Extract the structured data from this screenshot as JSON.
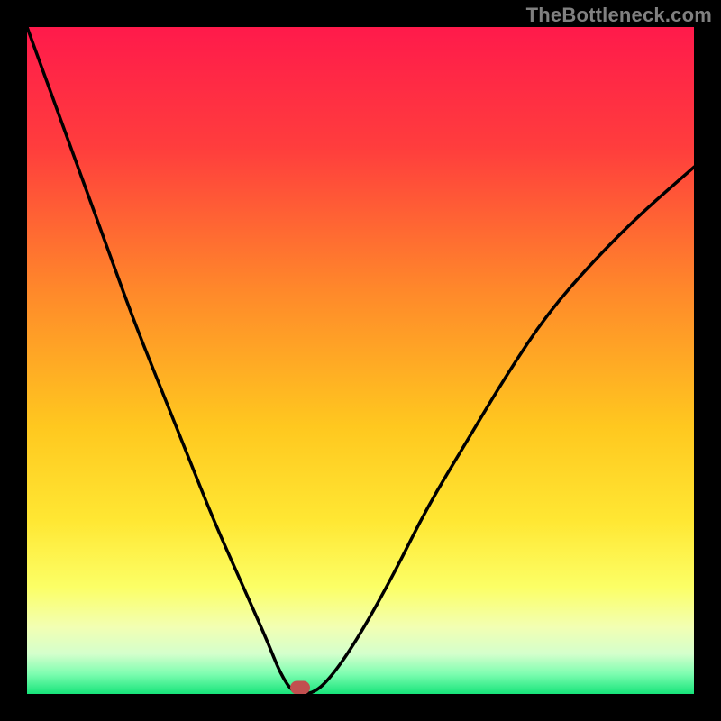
{
  "watermark": "TheBottleneck.com",
  "marker": {
    "color": "#c14f4f",
    "x_percent": 41,
    "y_percent": 100
  },
  "gradient_stops": [
    {
      "pct": 0,
      "color": "#ff1a4b"
    },
    {
      "pct": 18,
      "color": "#ff3d3d"
    },
    {
      "pct": 40,
      "color": "#ff8a2a"
    },
    {
      "pct": 60,
      "color": "#ffc81f"
    },
    {
      "pct": 74,
      "color": "#ffe733"
    },
    {
      "pct": 84,
      "color": "#fcff66"
    },
    {
      "pct": 90,
      "color": "#f2ffb3"
    },
    {
      "pct": 94,
      "color": "#d4ffcc"
    },
    {
      "pct": 97,
      "color": "#7dfdb0"
    },
    {
      "pct": 100,
      "color": "#17e47a"
    }
  ],
  "chart_data": {
    "type": "line",
    "title": "",
    "xlabel": "",
    "ylabel": "",
    "xlim": [
      0,
      100
    ],
    "ylim": [
      0,
      100
    ],
    "series": [
      {
        "name": "curve",
        "x": [
          0,
          4,
          8,
          12,
          16,
          20,
          24,
          28,
          32,
          36,
          38,
          40,
          43,
          46,
          50,
          55,
          60,
          66,
          72,
          78,
          85,
          92,
          100
        ],
        "y": [
          100,
          89,
          78,
          67,
          56,
          46,
          36,
          26,
          17,
          8,
          3,
          0,
          0,
          3,
          9,
          18,
          28,
          38,
          48,
          57,
          65,
          72,
          79
        ]
      }
    ],
    "marker_point": {
      "x": 41,
      "y": 0
    }
  }
}
